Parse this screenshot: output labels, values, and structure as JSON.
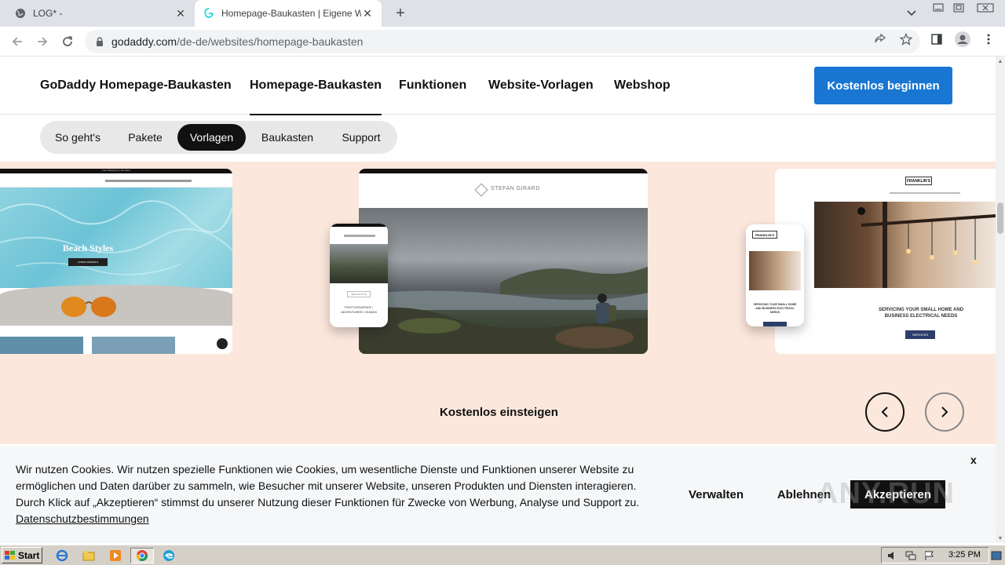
{
  "browser": {
    "tabs": [
      {
        "title": "LOG* -",
        "active": false
      },
      {
        "title": "Homepage-Baukasten | Eigene Webs",
        "active": true
      }
    ],
    "url_host": "godaddy.com",
    "url_path": "/de-de/websites/homepage-baukasten"
  },
  "site": {
    "brand": "GoDaddy Homepage-Baukasten",
    "nav": [
      "Homepage-Baukasten",
      "Funktionen",
      "Website-Vorlagen",
      "Webshop"
    ],
    "cta": "Kostenlos beginnen",
    "subnav": [
      "So geht's",
      "Pakete",
      "Vorlagen",
      "Baukasten",
      "Support"
    ],
    "subnav_active": "Vorlagen",
    "templates": {
      "beach": {
        "heading": "Beach Styles",
        "button": "LATEST ARRIVALS",
        "banner": "Free Shipping on all orders"
      },
      "photo": {
        "logo": "STEFAN GIRARD",
        "phone_caption": "PHOTOGRAPHER / ADVENTURER / HUMAN",
        "phone_button": "SEE PHOTOS"
      },
      "electric": {
        "logo": "FRANKLIN'S",
        "heading": "SERVICING YOUR SMALL HOME AND BUSINESS ELECTRICAL NEEDS",
        "phone_heading": "SERVICING YOUR SMALL HOME AND BUSINESS ELECTRICAL NEEDS",
        "button": "SERVICES"
      }
    },
    "start_text": "Kostenlos einsteigen"
  },
  "cookie": {
    "text": "Wir nutzen Cookies. Wir nutzen spezielle Funktionen wie Cookies, um wesentliche Dienste und Funktionen unserer Website zu ermöglichen und Daten darüber zu sammeln, wie Besucher mit unserer Website, unseren Produkten und Diensten interagieren. Durch Klick auf „Akzeptieren“ stimmst du unserer Nutzung dieser Funktionen für Zwecke von Werbung, Analyse und Support zu.",
    "link": "Datenschutzbestimmungen",
    "manage": "Verwalten",
    "decline": "Ablehnen",
    "accept": "Akzeptieren",
    "close": "x"
  },
  "watermark": "ANY.RUN",
  "taskbar": {
    "start": "Start",
    "clock": "3:25 PM"
  },
  "colors": {
    "cta": "#1976d2",
    "hero_bg": "#fbe7dc",
    "cookie_bg": "#f5f7f9"
  }
}
